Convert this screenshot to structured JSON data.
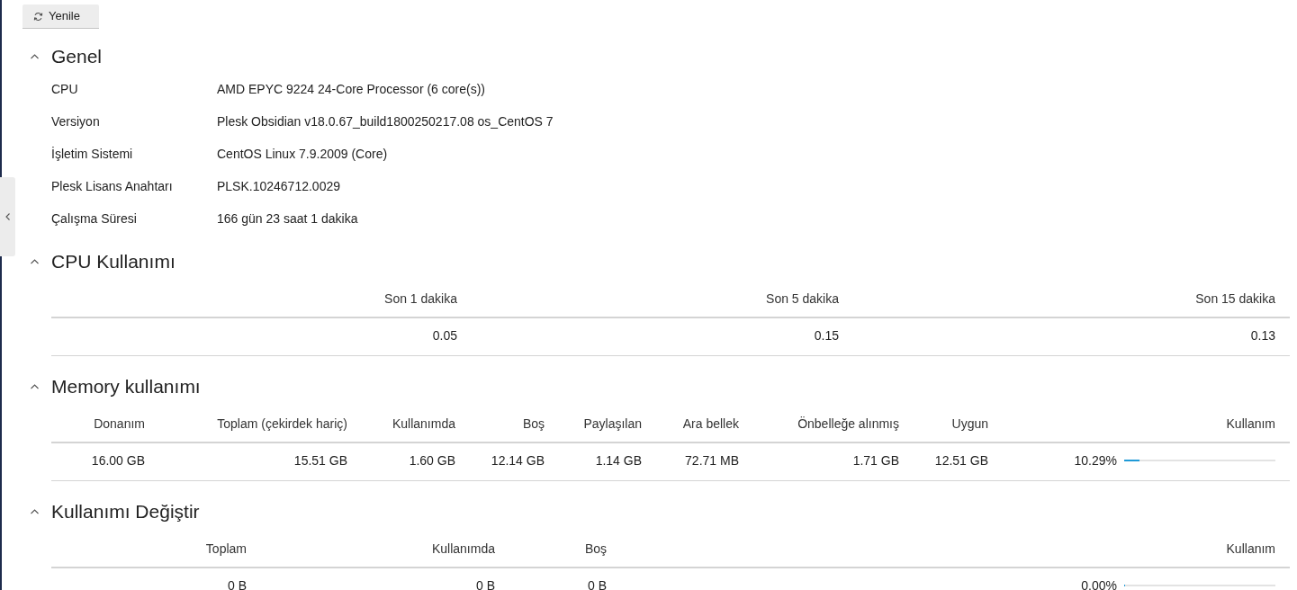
{
  "toolbar": {
    "refresh_button": "Yenile"
  },
  "sections": [
    {
      "kind": "properties",
      "title": "Genel",
      "expanded": true,
      "properties": [
        {
          "label": "CPU",
          "value": "AMD EPYC 9224 24-Core Processor (6 core(s))"
        },
        {
          "label": "Versiyon",
          "value": "Plesk Obsidian v18.0.67_build1800250217.08 os_CentOS 7"
        },
        {
          "label": "İşletim Sistemi",
          "value": "CentOS Linux 7.9.2009 (Core)"
        },
        {
          "label": "Plesk Lisans Anahtarı",
          "value": "PLSK.10246712.0029"
        },
        {
          "label": "Çalışma Süresi",
          "value": "166 gün 23 saat 1 dakika"
        }
      ]
    },
    {
      "kind": "table",
      "title": "CPU Kullanımı",
      "expanded": true,
      "columns": [
        "Son 1 dakika",
        "Son 5 dakika",
        "Son 15 dakika"
      ],
      "rows": [
        {
          "cells": [
            {
              "kind": "text",
              "text": "0.05"
            },
            {
              "kind": "text",
              "text": "0.15"
            },
            {
              "kind": "text",
              "text": "0.13"
            }
          ]
        }
      ]
    },
    {
      "kind": "table",
      "title": "Memory kullanımı",
      "expanded": true,
      "columns": [
        "Donanım",
        "Toplam (çekirdek hariç)",
        "Kullanımda",
        "Boş",
        "Paylaşılan",
        "Ara bellek",
        "Önbelleğe alınmış",
        "Uygun",
        "Kullanım"
      ],
      "rows": [
        {
          "cells": [
            {
              "kind": "text",
              "text": "16.00 GB"
            },
            {
              "kind": "text",
              "text": "15.51 GB"
            },
            {
              "kind": "text",
              "text": "1.60 GB"
            },
            {
              "kind": "text",
              "text": "12.14 GB"
            },
            {
              "kind": "text",
              "text": "1.14 GB"
            },
            {
              "kind": "text",
              "text": "72.71 MB"
            },
            {
              "kind": "text",
              "text": "1.71 GB"
            },
            {
              "kind": "text",
              "text": "12.51 GB"
            },
            {
              "kind": "usage",
              "text": "10.29%",
              "level": 0.1029
            }
          ]
        }
      ]
    },
    {
      "kind": "table",
      "title": "Kullanımı Değiştir",
      "expanded": true,
      "columns": [
        "Toplam",
        "Kullanımda",
        "Boş",
        "Kullanım"
      ],
      "rows": [
        {
          "cells": [
            {
              "kind": "text",
              "text": "0 B"
            },
            {
              "kind": "text",
              "text": "0 B"
            },
            {
              "kind": "text",
              "text": "0 B"
            },
            {
              "kind": "usage",
              "text": "0.00%",
              "level": 0
            }
          ]
        }
      ]
    }
  ]
}
